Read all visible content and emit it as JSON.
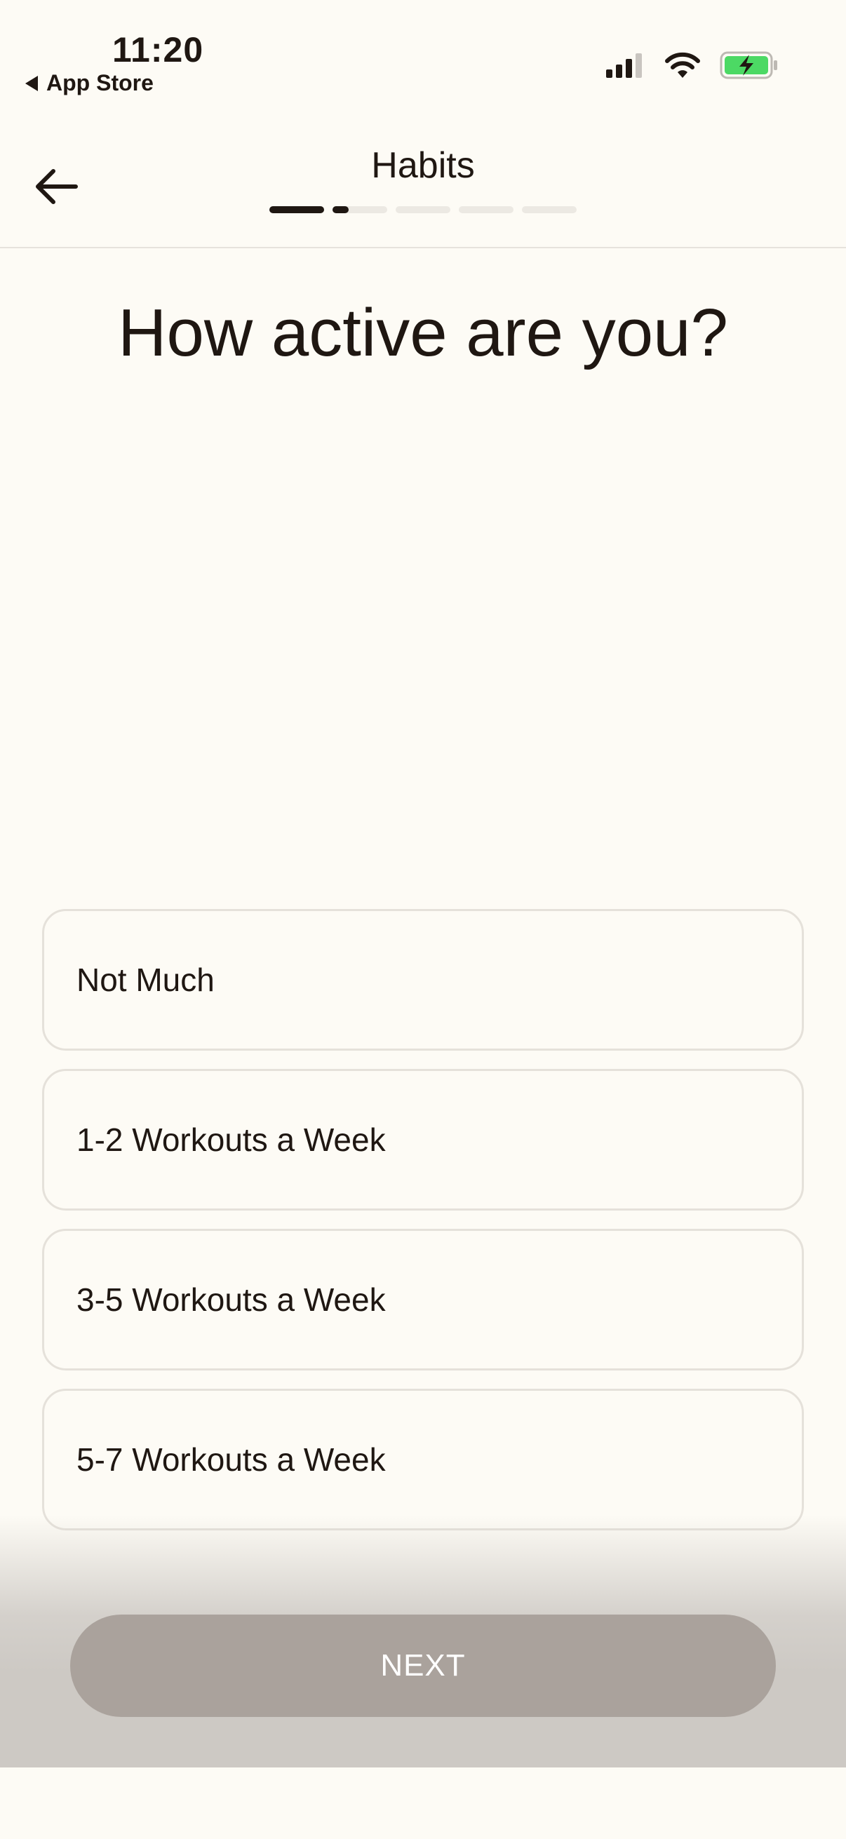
{
  "status_bar": {
    "time": "11:20",
    "back_app_label": "App Store"
  },
  "nav": {
    "title": "Habits",
    "progress": {
      "steps": 5,
      "current_step": 2,
      "current_step_fill": 0.3
    }
  },
  "question": "How active are you?",
  "options": [
    "Not Much",
    "1-2 Workouts a Week",
    "3-5 Workouts a Week",
    "5-7 Workouts a Week"
  ],
  "next_button_label": "NEXT",
  "colors": {
    "background": "#fdfbf5",
    "text": "#1f1712",
    "next_button_disabled": "#aaa29c",
    "battery_green": "#4cd964"
  }
}
